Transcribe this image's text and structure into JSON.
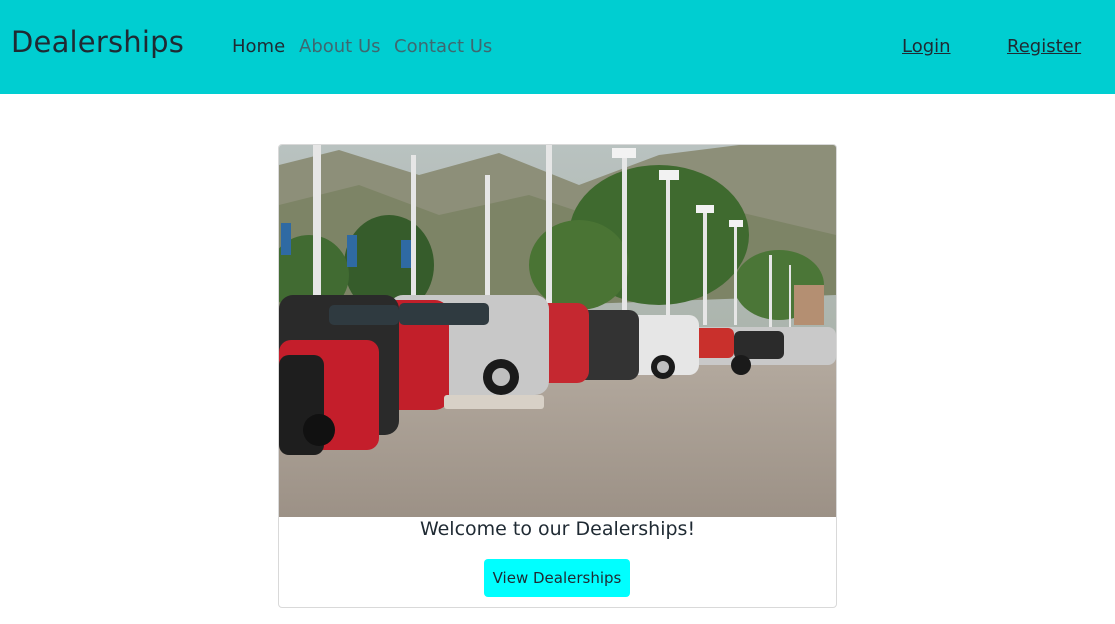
{
  "header": {
    "brand": "Dealerships",
    "nav": {
      "home": "Home",
      "about": "About Us",
      "contact": "Contact Us"
    },
    "auth": {
      "login": "Login",
      "register": "Register"
    }
  },
  "main": {
    "card": {
      "image_icon": "car-lot-photo",
      "text": "Welcome to our Dealerships!",
      "button_label": "View Dealerships"
    }
  },
  "colors": {
    "navbar": "#00ced1",
    "button": "#00ffff"
  }
}
